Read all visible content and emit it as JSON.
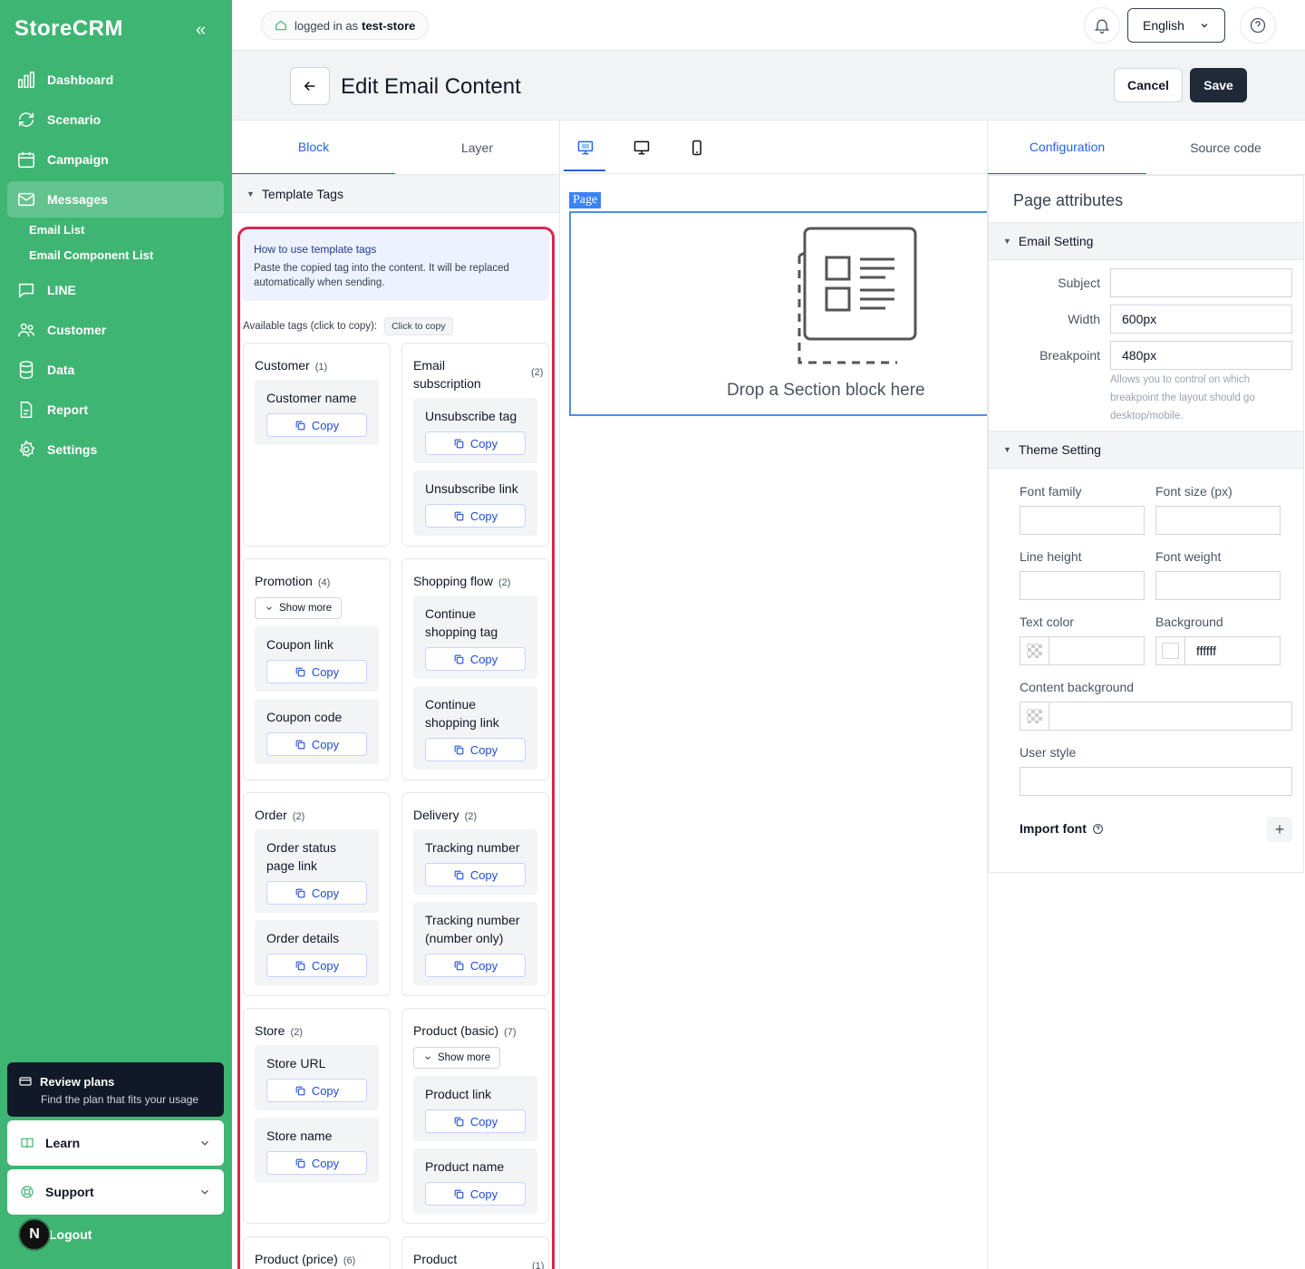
{
  "brand": "StoreCRM",
  "nav": {
    "dashboard": "Dashboard",
    "scenario": "Scenario",
    "campaign": "Campaign",
    "messages": "Messages",
    "email_list": "Email List",
    "email_component_list": "Email Component List",
    "line": "LINE",
    "customer": "Customer",
    "data": "Data",
    "report": "Report",
    "settings": "Settings"
  },
  "plans": {
    "title": "Review plans",
    "subtitle": "Find the plan that fits your usage"
  },
  "learn": "Learn",
  "support": "Support",
  "logout": "Logout",
  "avatar_initial": "N",
  "topbar": {
    "login_prefix": "logged in as",
    "store": "test-store",
    "language": "English"
  },
  "header": {
    "title": "Edit Email Content",
    "cancel": "Cancel",
    "save": "Save"
  },
  "left_tabs": {
    "block": "Block",
    "layer": "Layer"
  },
  "template_tags": {
    "heading": "Template Tags",
    "info_title": "How to use template tags",
    "info_desc": "Paste the copied tag into the content. It will be replaced automatically when sending.",
    "available": "Available tags (click to copy):",
    "click_to_copy": "Click to copy",
    "copy": "Copy",
    "show_more": "Show more",
    "groups": {
      "customer": {
        "title": "Customer",
        "count": "(1)",
        "tags": [
          "Customer name"
        ]
      },
      "email_sub": {
        "title": "Email subscription",
        "count": "(2)",
        "tags": [
          "Unsubscribe tag",
          "Unsubscribe link"
        ]
      },
      "promotion": {
        "title": "Promotion",
        "count": "(4)",
        "tags": [
          "Coupon link",
          "Coupon code"
        ]
      },
      "shopping": {
        "title": "Shopping flow",
        "count": "(2)",
        "tags": [
          "Continue shopping tag",
          "Continue shopping link"
        ]
      },
      "order": {
        "title": "Order",
        "count": "(2)",
        "tags": [
          "Order status page link",
          "Order details"
        ]
      },
      "delivery": {
        "title": "Delivery",
        "count": "(2)",
        "tags": [
          "Tracking number",
          "Tracking number (number only)"
        ]
      },
      "store": {
        "title": "Store",
        "count": "(2)",
        "tags": [
          "Store URL",
          "Store name"
        ]
      },
      "product_basic": {
        "title": "Product (basic)",
        "count": "(7)",
        "tags": [
          "Product link",
          "Product name"
        ]
      },
      "product_price": {
        "title": "Product (price)",
        "count": "(6)"
      },
      "product_other": {
        "title": "Product",
        "count": "(1)"
      }
    }
  },
  "canvas": {
    "page_tag": "Page",
    "drop_text": "Drop a Section block here"
  },
  "right_tabs": {
    "configuration": "Configuration",
    "source_code": "Source code"
  },
  "config": {
    "page_attributes": "Page attributes",
    "email_setting": "Email Setting",
    "subject_label": "Subject",
    "subject_value": "",
    "width_label": "Width",
    "width_value": "600px",
    "breakpoint_label": "Breakpoint",
    "breakpoint_value": "480px",
    "breakpoint_help": "Allows you to control on which breakpoint the layout should go desktop/mobile.",
    "theme_setting": "Theme Setting",
    "font_family": "Font family",
    "font_size": "Font size (px)",
    "line_height": "Line height",
    "font_weight": "Font weight",
    "text_color": "Text color",
    "background": "Background",
    "background_value": "ffffff",
    "content_background": "Content background",
    "user_style": "User style",
    "import_font": "Import font"
  },
  "colors": {
    "sidebar": "#3fb573",
    "accent": "#2563eb",
    "highlight": "#dc2650"
  }
}
